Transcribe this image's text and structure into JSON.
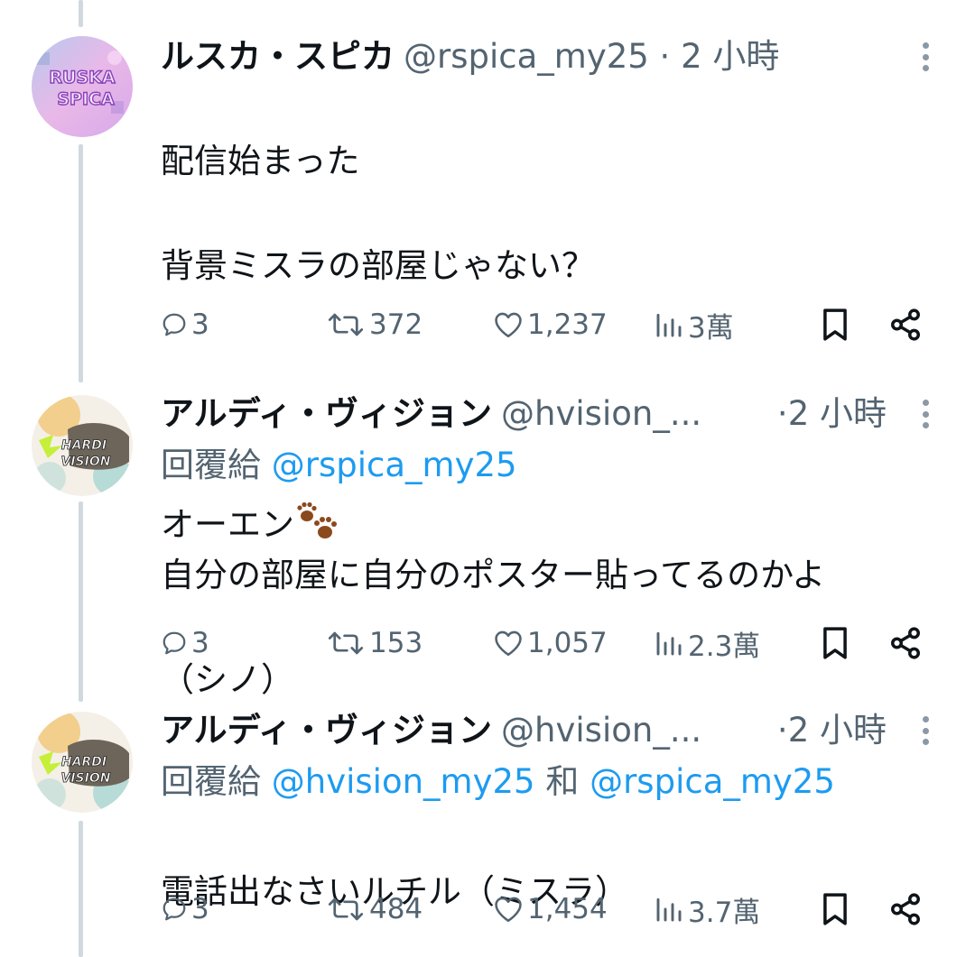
{
  "tweets": [
    {
      "name": "ルスカ・スピカ",
      "handle": "@rspica_my25",
      "dot": " · ",
      "time": "2 小時",
      "lines": [
        "配信始まった",
        "背景ミスラの部屋じゃない？",
        "",
        "オーエン"
      ],
      "emoji": "paw-prints",
      "avatar_text": [
        "RUSKA",
        "SPICA"
      ],
      "counts": {
        "reply": "3",
        "retweet": "372",
        "like": "1,237",
        "views": "3萬"
      }
    },
    {
      "name": "アルディ・ヴィジョン",
      "handle": "@hvision_...",
      "dot": "·",
      "time": "2 小時",
      "reply_prefix": "回覆給 ",
      "reply_mentions": "@rspica_my25",
      "lines": [
        "自分の部屋に自分のポスター貼ってるのかよ",
        "（シノ）"
      ],
      "avatar_text": [
        "HARDI",
        "VISION"
      ],
      "counts": {
        "reply": "3",
        "retweet": "153",
        "like": "1,057",
        "views": "2.3萬"
      }
    },
    {
      "name": "アルディ・ヴィジョン",
      "handle": "@hvision_...",
      "dot": "·",
      "time": "2 小時",
      "reply_prefix": "回覆給 ",
      "reply_mention_1": "@hvision_my25",
      "reply_and": " 和 ",
      "reply_mention_2": "@rspica_my25",
      "lines": [
        "電話出なさいルチル（ミスラ）"
      ],
      "avatar_text": [
        "HARDI",
        "VISION"
      ],
      "counts": {
        "reply": "3",
        "retweet": "484",
        "like": "1,454",
        "views": "3.7萬"
      }
    }
  ],
  "icons": [
    "more-vertical-icon",
    "reply-icon",
    "retweet-icon",
    "like-icon",
    "views-icon",
    "bookmark-icon",
    "share-icon",
    "paw-prints-emoji"
  ],
  "colors": {
    "text": "#0f1419",
    "secondary": "#536471",
    "accent": "#1d9bf0",
    "thread_line": "#cfd9de"
  }
}
